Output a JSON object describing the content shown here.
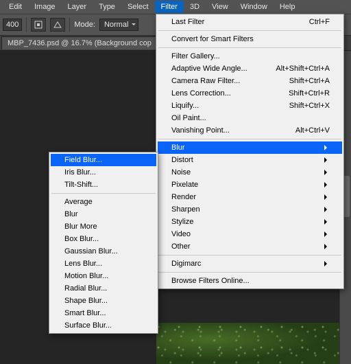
{
  "menubar": {
    "items": [
      "Edit",
      "Image",
      "Layer",
      "Type",
      "Select",
      "Filter",
      "3D",
      "View",
      "Window",
      "Help"
    ],
    "open_index": 5
  },
  "toolbar": {
    "field_value": "400",
    "mode_label": "Mode:",
    "mode_value": "Normal"
  },
  "document": {
    "tab_title": "MBP_7436.psd @ 16.7% (Background cop"
  },
  "filter_menu": [
    {
      "type": "item",
      "label": "Last Filter",
      "shortcut": "Ctrl+F"
    },
    {
      "type": "divider"
    },
    {
      "type": "item",
      "label": "Convert for Smart Filters"
    },
    {
      "type": "divider"
    },
    {
      "type": "item",
      "label": "Filter Gallery..."
    },
    {
      "type": "item",
      "label": "Adaptive Wide Angle...",
      "shortcut": "Alt+Shift+Ctrl+A"
    },
    {
      "type": "item",
      "label": "Camera Raw Filter...",
      "shortcut": "Shift+Ctrl+A"
    },
    {
      "type": "item",
      "label": "Lens Correction...",
      "shortcut": "Shift+Ctrl+R"
    },
    {
      "type": "item",
      "label": "Liquify...",
      "shortcut": "Shift+Ctrl+X"
    },
    {
      "type": "item",
      "label": "Oil Paint..."
    },
    {
      "type": "item",
      "label": "Vanishing Point...",
      "shortcut": "Alt+Ctrl+V"
    },
    {
      "type": "divider"
    },
    {
      "type": "item",
      "label": "Blur",
      "submenu": true,
      "highlight": true
    },
    {
      "type": "item",
      "label": "Distort",
      "submenu": true
    },
    {
      "type": "item",
      "label": "Noise",
      "submenu": true
    },
    {
      "type": "item",
      "label": "Pixelate",
      "submenu": true
    },
    {
      "type": "item",
      "label": "Render",
      "submenu": true
    },
    {
      "type": "item",
      "label": "Sharpen",
      "submenu": true
    },
    {
      "type": "item",
      "label": "Stylize",
      "submenu": true
    },
    {
      "type": "item",
      "label": "Video",
      "submenu": true
    },
    {
      "type": "item",
      "label": "Other",
      "submenu": true
    },
    {
      "type": "divider"
    },
    {
      "type": "item",
      "label": "Digimarc",
      "submenu": true
    },
    {
      "type": "divider"
    },
    {
      "type": "item",
      "label": "Browse Filters Online..."
    }
  ],
  "blur_submenu": [
    {
      "type": "item",
      "label": "Field Blur...",
      "highlight": true
    },
    {
      "type": "item",
      "label": "Iris Blur..."
    },
    {
      "type": "item",
      "label": "Tilt-Shift..."
    },
    {
      "type": "divider"
    },
    {
      "type": "item",
      "label": "Average"
    },
    {
      "type": "item",
      "label": "Blur"
    },
    {
      "type": "item",
      "label": "Blur More"
    },
    {
      "type": "item",
      "label": "Box Blur..."
    },
    {
      "type": "item",
      "label": "Gaussian Blur..."
    },
    {
      "type": "item",
      "label": "Lens Blur..."
    },
    {
      "type": "item",
      "label": "Motion Blur..."
    },
    {
      "type": "item",
      "label": "Radial Blur..."
    },
    {
      "type": "item",
      "label": "Shape Blur..."
    },
    {
      "type": "item",
      "label": "Smart Blur..."
    },
    {
      "type": "item",
      "label": "Surface Blur..."
    }
  ]
}
